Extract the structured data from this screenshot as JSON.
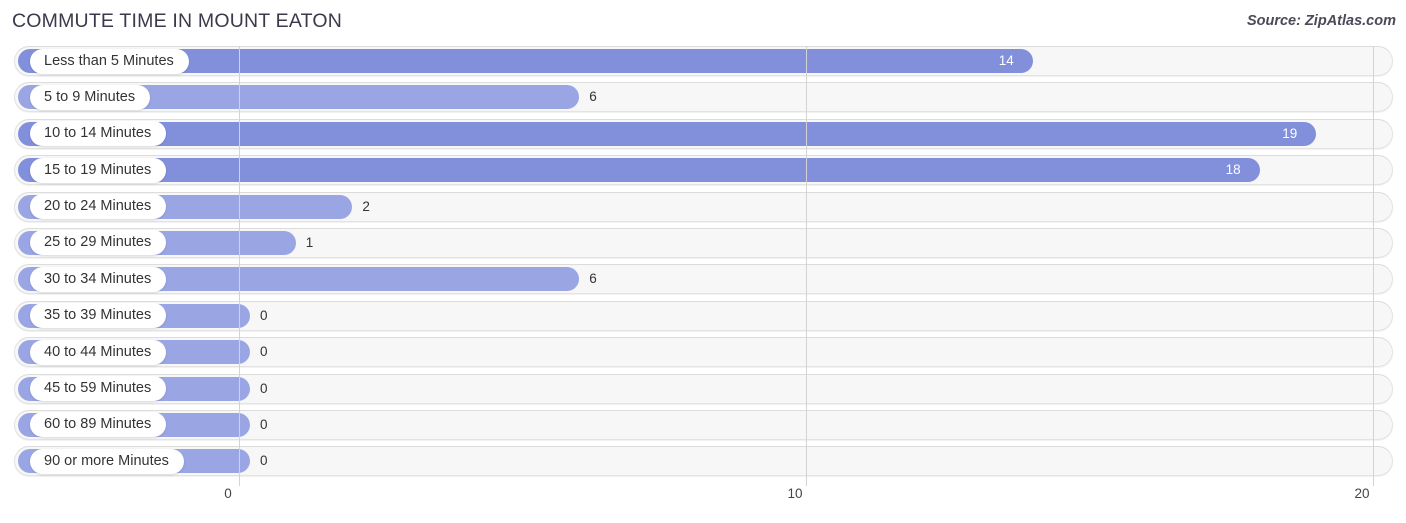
{
  "header": {
    "title": "COMMUTE TIME IN MOUNT EATON",
    "source": "Source: ZipAtlas.com"
  },
  "colors": {
    "bar": "#8290dc",
    "bar_light": "#9aa5e4",
    "track": "#f7f7f7",
    "gridline": "#d3d3d3",
    "label_pill": "#ffffff",
    "value_inside": "#ffffff",
    "value_outside": "#333333",
    "title": "#3a3a4a"
  },
  "chart_data": {
    "type": "bar",
    "orientation": "horizontal",
    "title": "COMMUTE TIME IN MOUNT EATON",
    "subtitle": "",
    "xlabel": "",
    "ylabel": "",
    "xlim": [
      0,
      20
    ],
    "ticks": [
      "0",
      "10",
      "20"
    ],
    "tick_values": [
      0,
      10,
      20
    ],
    "grid": true,
    "legend": "none",
    "source": "Source: ZipAtlas.com",
    "categories": [
      "Less than 5 Minutes",
      "5 to 9 Minutes",
      "10 to 14 Minutes",
      "15 to 19 Minutes",
      "20 to 24 Minutes",
      "25 to 29 Minutes",
      "30 to 34 Minutes",
      "35 to 39 Minutes",
      "40 to 44 Minutes",
      "45 to 59 Minutes",
      "60 to 89 Minutes",
      "90 or more Minutes"
    ],
    "values": [
      14,
      6,
      19,
      18,
      2,
      1,
      6,
      0,
      0,
      0,
      0,
      0
    ],
    "value_labels": [
      "14",
      "6",
      "19",
      "18",
      "2",
      "1",
      "6",
      "0",
      "0",
      "0",
      "0",
      "0"
    ]
  },
  "rows": [
    {
      "label": "Less than 5 Minutes",
      "value": 14,
      "value_label": "14",
      "inside": true
    },
    {
      "label": "5 to 9 Minutes",
      "value": 6,
      "value_label": "6",
      "inside": false
    },
    {
      "label": "10 to 14 Minutes",
      "value": 19,
      "value_label": "19",
      "inside": true
    },
    {
      "label": "15 to 19 Minutes",
      "value": 18,
      "value_label": "18",
      "inside": true
    },
    {
      "label": "20 to 24 Minutes",
      "value": 2,
      "value_label": "2",
      "inside": false
    },
    {
      "label": "25 to 29 Minutes",
      "value": 1,
      "value_label": "1",
      "inside": false
    },
    {
      "label": "30 to 34 Minutes",
      "value": 6,
      "value_label": "6",
      "inside": false
    },
    {
      "label": "35 to 39 Minutes",
      "value": 0,
      "value_label": "0",
      "inside": false
    },
    {
      "label": "40 to 44 Minutes",
      "value": 0,
      "value_label": "0",
      "inside": false
    },
    {
      "label": "45 to 59 Minutes",
      "value": 0,
      "value_label": "0",
      "inside": false
    },
    {
      "label": "60 to 89 Minutes",
      "value": 0,
      "value_label": "0",
      "inside": false
    },
    {
      "label": "90 or more Minutes",
      "value": 0,
      "value_label": "0",
      "inside": false
    }
  ]
}
